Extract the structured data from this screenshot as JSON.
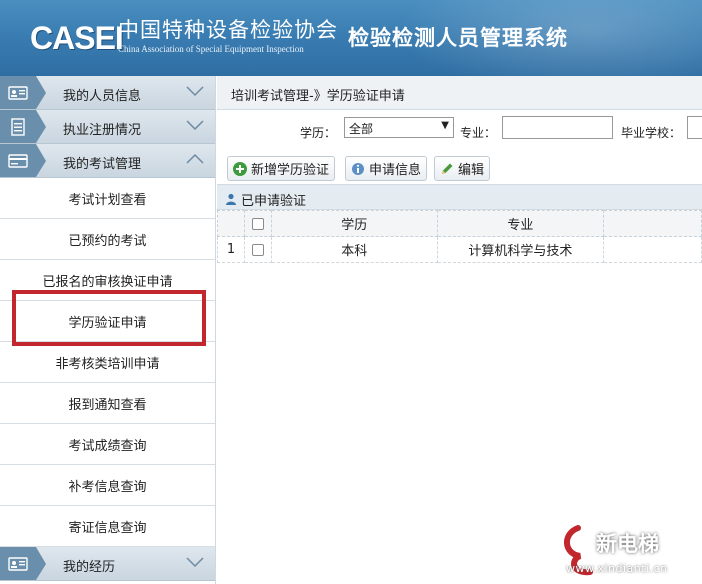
{
  "header": {
    "logo": "CASEI",
    "org_name_cn": "中国特种设备检验协会",
    "org_name_en": "China Association of Special Equipment Inspection",
    "system_title": "检验检测人员管理系统"
  },
  "sidebar": {
    "groups": [
      {
        "label": "我的人员信息",
        "icon": "id-card-icon",
        "state": "collapsed"
      },
      {
        "label": "执业注册情况",
        "icon": "document-icon",
        "state": "collapsed"
      },
      {
        "label": "我的考试管理",
        "icon": "card-icon",
        "state": "expanded"
      }
    ],
    "items": [
      {
        "label": "考试计划查看"
      },
      {
        "label": "已预约的考试"
      },
      {
        "label": "已报名的审核换证申请"
      },
      {
        "label": "学历验证申请"
      },
      {
        "label": "非考核类培训申请"
      },
      {
        "label": "报到通知查看"
      },
      {
        "label": "考试成绩查询"
      },
      {
        "label": "补考信息查询"
      },
      {
        "label": "寄证信息查询"
      }
    ],
    "last_group": {
      "label": "我的经历",
      "icon": "id-card-icon",
      "state": "collapsed"
    },
    "highlight_color": "#c1272d"
  },
  "main": {
    "breadcrumb": "培训考试管理-》学历验证申请",
    "filters": {
      "education_label": "学历：",
      "education_value": "全部",
      "major_label": "专业：",
      "school_label": "毕业学校："
    },
    "toolbar": {
      "add_label": "新增学历验证",
      "info_label": "申请信息",
      "edit_label": "编辑"
    },
    "table": {
      "title": "已申请验证",
      "columns": [
        "学历",
        "专业"
      ],
      "rows": [
        {
          "index": "1",
          "education": "本科",
          "major": "计算机科学与技术"
        }
      ]
    }
  },
  "watermark": {
    "text": "新电梯",
    "url": "www.xindianti.cn"
  }
}
